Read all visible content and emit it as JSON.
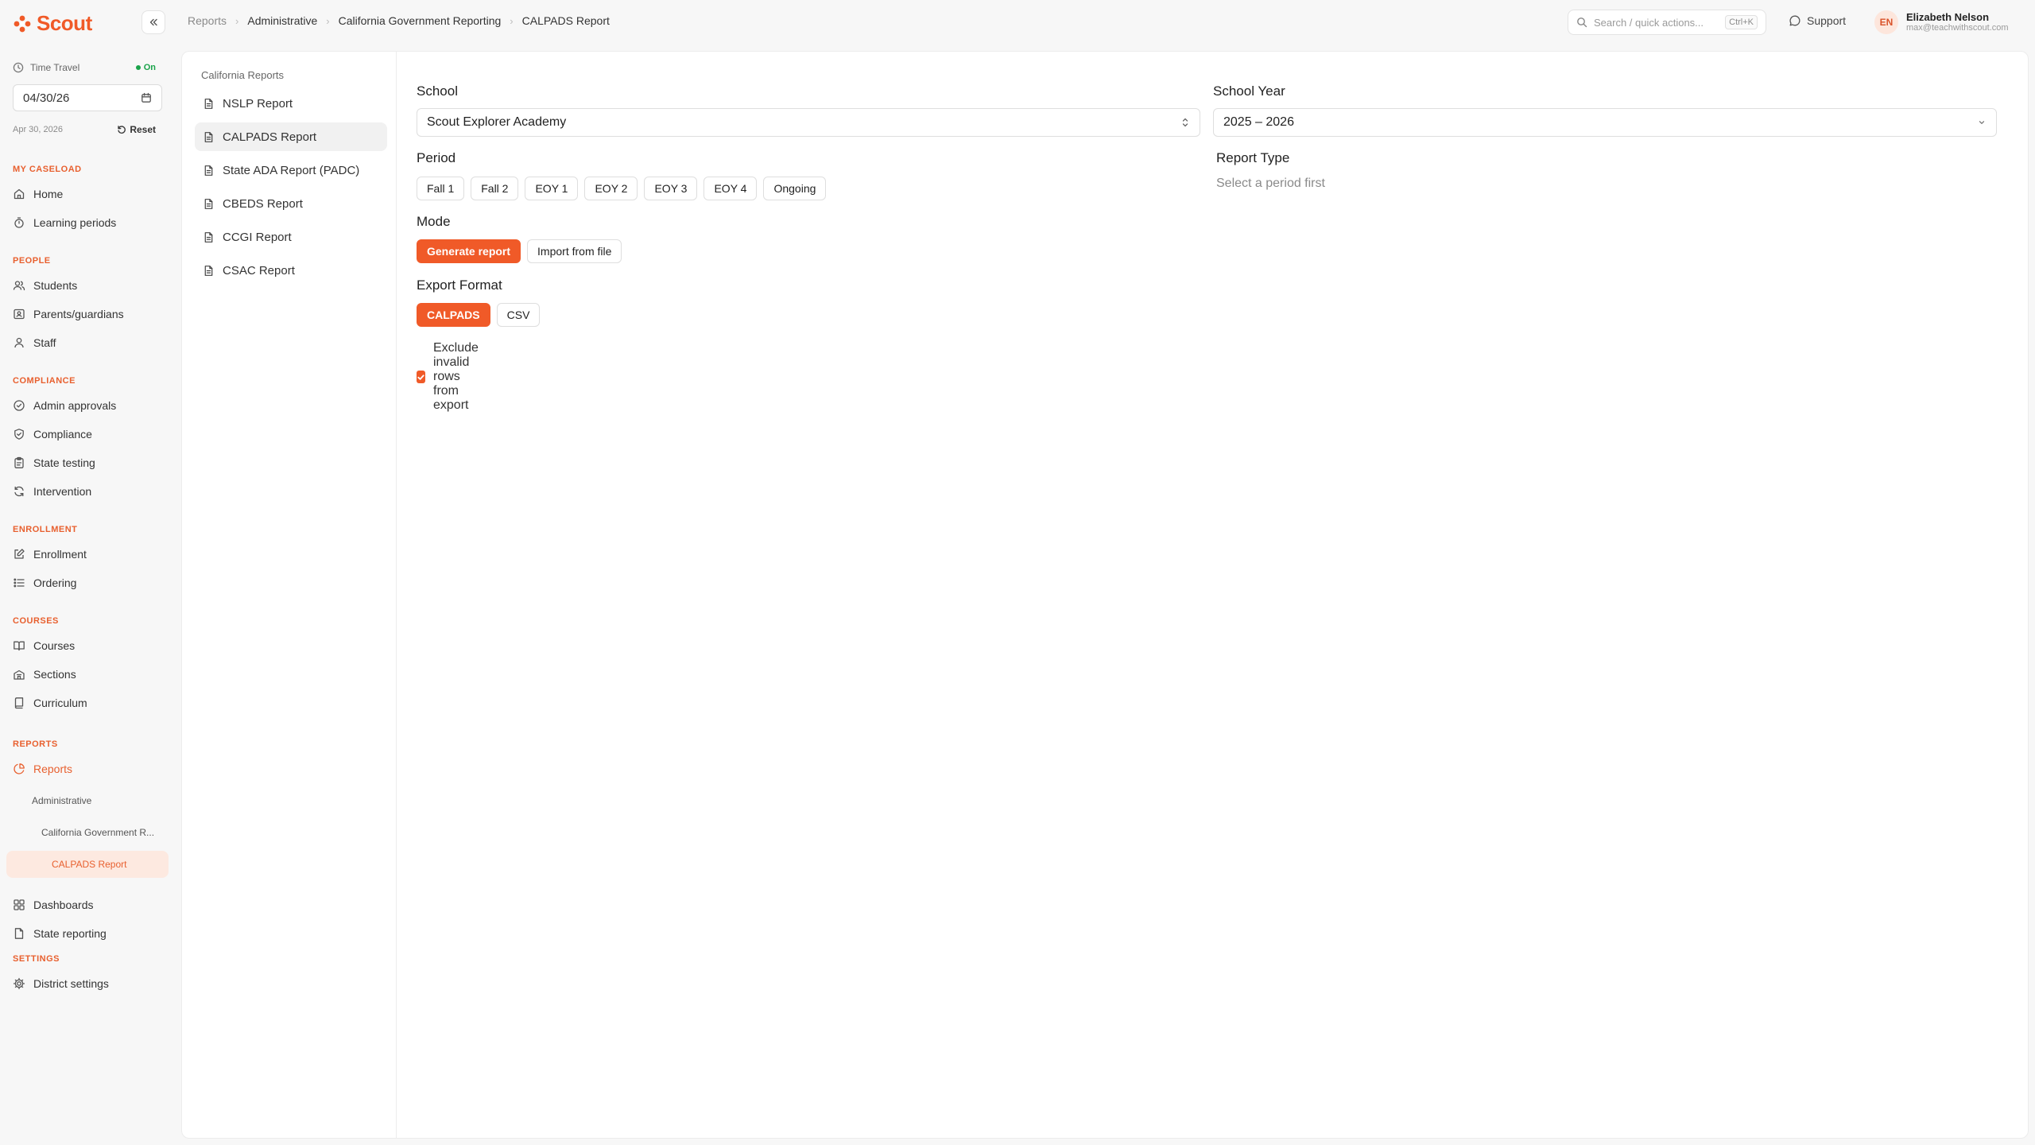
{
  "brand": {
    "name": "Scout",
    "accent": "#f05a28"
  },
  "breadcrumb": [
    "Reports",
    "Administrative",
    "California Government Reporting",
    "CALPADS Report"
  ],
  "search": {
    "placeholder": "Search / quick actions...",
    "shortcut": "Ctrl+K"
  },
  "support_label": "Support",
  "user": {
    "initials": "EN",
    "name": "Elizabeth Nelson",
    "email": "max@teachwithscout.com"
  },
  "time_travel": {
    "label": "Time Travel",
    "status": "On",
    "date": "04/30/26",
    "date_long": "Apr 30, 2026",
    "reset_label": "Reset"
  },
  "nav": {
    "caseload": {
      "title": "MY CASELOAD",
      "items": [
        "Home",
        "Learning periods"
      ]
    },
    "people": {
      "title": "PEOPLE",
      "items": [
        "Students",
        "Parents/guardians",
        "Staff"
      ]
    },
    "compliance": {
      "title": "COMPLIANCE",
      "items": [
        "Admin approvals",
        "Compliance",
        "State testing",
        "Intervention"
      ]
    },
    "enrollment": {
      "title": "ENROLLMENT",
      "items": [
        "Enrollment",
        "Ordering"
      ]
    },
    "courses": {
      "title": "COURSES",
      "items": [
        "Courses",
        "Sections",
        "Curriculum"
      ]
    },
    "reports": {
      "title": "REPORTS",
      "items": [
        "Reports",
        "Dashboards",
        "State reporting"
      ],
      "sub": [
        "Administrative",
        "California Government R...",
        "CALPADS Report"
      ]
    },
    "settings": {
      "title": "SETTINGS",
      "items": [
        "District settings"
      ]
    }
  },
  "subnav": {
    "title": "California Reports",
    "items": [
      "NSLP Report",
      "CALPADS Report",
      "State ADA Report (PADC)",
      "CBEDS Report",
      "CCGI Report",
      "CSAC Report"
    ],
    "active_index": 1
  },
  "form": {
    "school": {
      "label": "School",
      "value": "Scout Explorer Academy"
    },
    "school_year": {
      "label": "School Year",
      "value": "2025 – 2026"
    },
    "period": {
      "label": "Period",
      "options": [
        "Fall 1",
        "Fall 2",
        "EOY 1",
        "EOY 2",
        "EOY 3",
        "EOY 4",
        "Ongoing"
      ]
    },
    "report_type": {
      "label": "Report Type",
      "placeholder": "Select a period first"
    },
    "mode": {
      "label": "Mode",
      "options": [
        "Generate report",
        "Import from file"
      ],
      "selected": "Generate report"
    },
    "export_format": {
      "label": "Export Format",
      "options": [
        "CALPADS",
        "CSV"
      ],
      "selected": "CALPADS"
    },
    "exclude_invalid": {
      "label": "Exclude invalid rows from export",
      "checked": true
    }
  }
}
